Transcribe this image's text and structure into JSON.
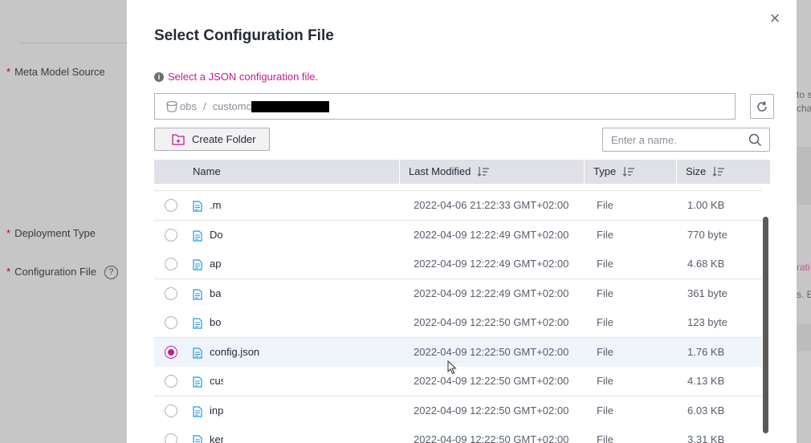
{
  "background": {
    "labels": {
      "meta_model_source": "Meta Model Source",
      "deployment_type": "Deployment Type",
      "configuration_file": "Configuration File",
      "required_marker": "*",
      "help": "?"
    },
    "right_edge_text": [
      "to s",
      "cha",
      "rati",
      "s. E"
    ]
  },
  "modal": {
    "title": "Select Configuration File",
    "close_label": "×",
    "hint": "Select a JSON configuration file.",
    "path": {
      "root": "obs",
      "separator": "/",
      "segment": "customc"
    },
    "create_folder_label": "Create Folder",
    "search_placeholder": "Enter a name."
  },
  "table": {
    "columns": {
      "name": "Name",
      "last_modified": "Last Modified",
      "type": "Type",
      "size": "Size"
    },
    "rows": [
      {
        "name": ".m",
        "modified": "2022-04-06 21:22:33 GMT+02:00",
        "type": "File",
        "size": "1.00 KB",
        "selected": false
      },
      {
        "name": "Do",
        "modified": "2022-04-09 12:22:49 GMT+02:00",
        "type": "File",
        "size": "770 byte",
        "selected": false
      },
      {
        "name": "ap",
        "modified": "2022-04-09 12:22:49 GMT+02:00",
        "type": "File",
        "size": "4.68 KB",
        "selected": false
      },
      {
        "name": "ba",
        "modified": "2022-04-09 12:22:49 GMT+02:00",
        "type": "File",
        "size": "361 byte",
        "selected": false
      },
      {
        "name": "bo",
        "modified": "2022-04-09 12:22:50 GMT+02:00",
        "type": "File",
        "size": "123 byte",
        "selected": false
      },
      {
        "name": "config.json",
        "modified": "2022-04-09 12:22:50 GMT+02:00",
        "type": "File",
        "size": "1.76 KB",
        "selected": true
      },
      {
        "name": "cus",
        "modified": "2022-04-09 12:22:50 GMT+02:00",
        "type": "File",
        "size": "4.13 KB",
        "selected": false
      },
      {
        "name": "inp",
        "modified": "2022-04-09 12:22:50 GMT+02:00",
        "type": "File",
        "size": "6.03 KB",
        "selected": false
      },
      {
        "name": "ker",
        "modified": "2022-04-09 12:22:50 GMT+02:00",
        "type": "File",
        "size": "3.31 KB",
        "selected": false
      }
    ]
  },
  "colors": {
    "accent": "#c7198b",
    "required": "#c7000b",
    "header_bg": "#dfe1e6",
    "selected_row_bg": "#eef4f9"
  },
  "icons": {
    "close": "close-icon",
    "info": "info-icon",
    "bucket": "bucket-icon",
    "refresh": "refresh-icon",
    "new_folder": "new-folder-icon",
    "search": "search-icon",
    "sort": "sort-icon",
    "file": "file-icon"
  }
}
